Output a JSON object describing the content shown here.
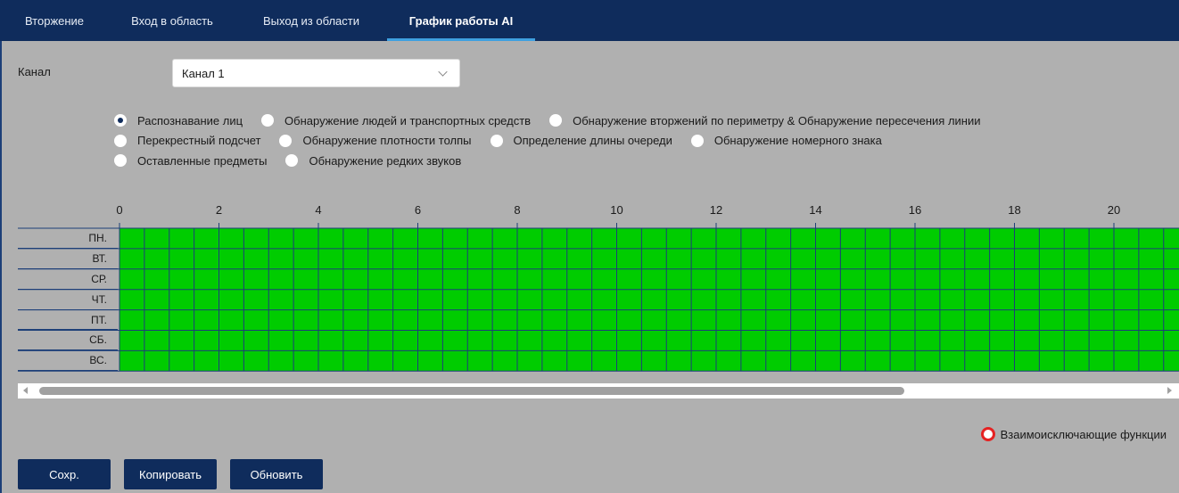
{
  "tabs": [
    {
      "label": "Вторжение",
      "active": false
    },
    {
      "label": "Вход в область",
      "active": false
    },
    {
      "label": "Выход из области",
      "active": false
    },
    {
      "label": "График работы AI",
      "active": true
    }
  ],
  "channel": {
    "label": "Канал",
    "value": "Канал 1"
  },
  "ai_functions": {
    "selected": "Распознавание лиц",
    "options": [
      [
        "Распознавание лиц",
        "Обнаружение людей и транспортных средств",
        "Обнаружение вторжений по периметру & Обнаружение пересечения линии"
      ],
      [
        "Перекрестный подсчет",
        "Обнаружение плотности толпы",
        "Определение длины очереди",
        "Обнаружение номерного знака"
      ],
      [
        "Оставленные предметы",
        "Обнаружение редких звуков"
      ]
    ]
  },
  "schedule": {
    "hour_labels": [
      "0",
      "2",
      "4",
      "6",
      "8",
      "10",
      "12",
      "14",
      "16",
      "18",
      "20"
    ],
    "days": [
      "ПН.",
      "ВТ.",
      "СР.",
      "ЧТ.",
      "ПТ.",
      "СБ.",
      "ВС."
    ],
    "active_all_day": true,
    "active_color": "#00cc00",
    "grid_color": "#1d3f78"
  },
  "mutual_exclusion": {
    "label": "Взаимоисключающие функции",
    "indicator_color": "#e52222"
  },
  "buttons": {
    "save": "Сохр.",
    "copy": "Копировать",
    "refresh": "Обновить"
  },
  "colors": {
    "header_bg": "#0f2c5c",
    "tab_underline": "#3ea0e0",
    "panel_bg": "#b0b0b0"
  }
}
